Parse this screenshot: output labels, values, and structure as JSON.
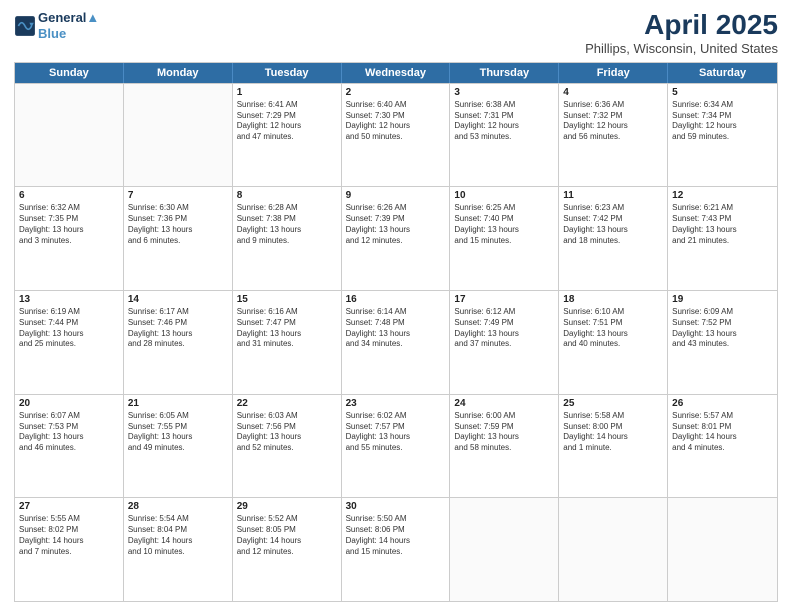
{
  "header": {
    "logo_line1": "General",
    "logo_line2": "Blue",
    "month": "April 2025",
    "location": "Phillips, Wisconsin, United States"
  },
  "days_of_week": [
    "Sunday",
    "Monday",
    "Tuesday",
    "Wednesday",
    "Thursday",
    "Friday",
    "Saturday"
  ],
  "weeks": [
    [
      {
        "day": "",
        "info": ""
      },
      {
        "day": "",
        "info": ""
      },
      {
        "day": "1",
        "info": "Sunrise: 6:41 AM\nSunset: 7:29 PM\nDaylight: 12 hours\nand 47 minutes."
      },
      {
        "day": "2",
        "info": "Sunrise: 6:40 AM\nSunset: 7:30 PM\nDaylight: 12 hours\nand 50 minutes."
      },
      {
        "day": "3",
        "info": "Sunrise: 6:38 AM\nSunset: 7:31 PM\nDaylight: 12 hours\nand 53 minutes."
      },
      {
        "day": "4",
        "info": "Sunrise: 6:36 AM\nSunset: 7:32 PM\nDaylight: 12 hours\nand 56 minutes."
      },
      {
        "day": "5",
        "info": "Sunrise: 6:34 AM\nSunset: 7:34 PM\nDaylight: 12 hours\nand 59 minutes."
      }
    ],
    [
      {
        "day": "6",
        "info": "Sunrise: 6:32 AM\nSunset: 7:35 PM\nDaylight: 13 hours\nand 3 minutes."
      },
      {
        "day": "7",
        "info": "Sunrise: 6:30 AM\nSunset: 7:36 PM\nDaylight: 13 hours\nand 6 minutes."
      },
      {
        "day": "8",
        "info": "Sunrise: 6:28 AM\nSunset: 7:38 PM\nDaylight: 13 hours\nand 9 minutes."
      },
      {
        "day": "9",
        "info": "Sunrise: 6:26 AM\nSunset: 7:39 PM\nDaylight: 13 hours\nand 12 minutes."
      },
      {
        "day": "10",
        "info": "Sunrise: 6:25 AM\nSunset: 7:40 PM\nDaylight: 13 hours\nand 15 minutes."
      },
      {
        "day": "11",
        "info": "Sunrise: 6:23 AM\nSunset: 7:42 PM\nDaylight: 13 hours\nand 18 minutes."
      },
      {
        "day": "12",
        "info": "Sunrise: 6:21 AM\nSunset: 7:43 PM\nDaylight: 13 hours\nand 21 minutes."
      }
    ],
    [
      {
        "day": "13",
        "info": "Sunrise: 6:19 AM\nSunset: 7:44 PM\nDaylight: 13 hours\nand 25 minutes."
      },
      {
        "day": "14",
        "info": "Sunrise: 6:17 AM\nSunset: 7:46 PM\nDaylight: 13 hours\nand 28 minutes."
      },
      {
        "day": "15",
        "info": "Sunrise: 6:16 AM\nSunset: 7:47 PM\nDaylight: 13 hours\nand 31 minutes."
      },
      {
        "day": "16",
        "info": "Sunrise: 6:14 AM\nSunset: 7:48 PM\nDaylight: 13 hours\nand 34 minutes."
      },
      {
        "day": "17",
        "info": "Sunrise: 6:12 AM\nSunset: 7:49 PM\nDaylight: 13 hours\nand 37 minutes."
      },
      {
        "day": "18",
        "info": "Sunrise: 6:10 AM\nSunset: 7:51 PM\nDaylight: 13 hours\nand 40 minutes."
      },
      {
        "day": "19",
        "info": "Sunrise: 6:09 AM\nSunset: 7:52 PM\nDaylight: 13 hours\nand 43 minutes."
      }
    ],
    [
      {
        "day": "20",
        "info": "Sunrise: 6:07 AM\nSunset: 7:53 PM\nDaylight: 13 hours\nand 46 minutes."
      },
      {
        "day": "21",
        "info": "Sunrise: 6:05 AM\nSunset: 7:55 PM\nDaylight: 13 hours\nand 49 minutes."
      },
      {
        "day": "22",
        "info": "Sunrise: 6:03 AM\nSunset: 7:56 PM\nDaylight: 13 hours\nand 52 minutes."
      },
      {
        "day": "23",
        "info": "Sunrise: 6:02 AM\nSunset: 7:57 PM\nDaylight: 13 hours\nand 55 minutes."
      },
      {
        "day": "24",
        "info": "Sunrise: 6:00 AM\nSunset: 7:59 PM\nDaylight: 13 hours\nand 58 minutes."
      },
      {
        "day": "25",
        "info": "Sunrise: 5:58 AM\nSunset: 8:00 PM\nDaylight: 14 hours\nand 1 minute."
      },
      {
        "day": "26",
        "info": "Sunrise: 5:57 AM\nSunset: 8:01 PM\nDaylight: 14 hours\nand 4 minutes."
      }
    ],
    [
      {
        "day": "27",
        "info": "Sunrise: 5:55 AM\nSunset: 8:02 PM\nDaylight: 14 hours\nand 7 minutes."
      },
      {
        "day": "28",
        "info": "Sunrise: 5:54 AM\nSunset: 8:04 PM\nDaylight: 14 hours\nand 10 minutes."
      },
      {
        "day": "29",
        "info": "Sunrise: 5:52 AM\nSunset: 8:05 PM\nDaylight: 14 hours\nand 12 minutes."
      },
      {
        "day": "30",
        "info": "Sunrise: 5:50 AM\nSunset: 8:06 PM\nDaylight: 14 hours\nand 15 minutes."
      },
      {
        "day": "",
        "info": ""
      },
      {
        "day": "",
        "info": ""
      },
      {
        "day": "",
        "info": ""
      }
    ]
  ]
}
